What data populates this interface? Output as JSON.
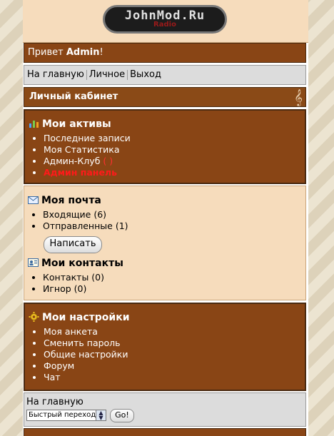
{
  "logo": {
    "main": "JohnMod.Ru",
    "sub": "Radio"
  },
  "greeting": {
    "prefix": "Привет ",
    "user": "Admin",
    "suffix": "!"
  },
  "nav": {
    "home": "На главную",
    "personal": "Личное",
    "logout": "Выход"
  },
  "cabinet": {
    "title": "Личный кабинет"
  },
  "assets": {
    "title": "Мои активы",
    "items": [
      "Последние записи",
      "Моя Статистика",
      "Админ-Клуб",
      "Админ панель"
    ],
    "club_count": "( )"
  },
  "mail": {
    "title": "Моя почта",
    "items": [
      "Входящие (6)",
      "Отправленные (1)"
    ],
    "write_button": "Написать"
  },
  "contacts": {
    "title": "Мои контакты",
    "items": [
      "Контакты (0)",
      "Игнор (0)"
    ]
  },
  "settings": {
    "title": "Мои настройки",
    "items": [
      "Моя анкета",
      "Сменить пароль",
      "Общие настройки",
      "Форум",
      "Чат"
    ]
  },
  "bottom": {
    "home": "На главную",
    "select_value": "Быстрый переход",
    "go": "Go!"
  },
  "colors": {
    "brown": "#894515",
    "tan": "#f6dcbc",
    "grey": "#dcdcdc",
    "red_link": "#ff1a1a"
  }
}
